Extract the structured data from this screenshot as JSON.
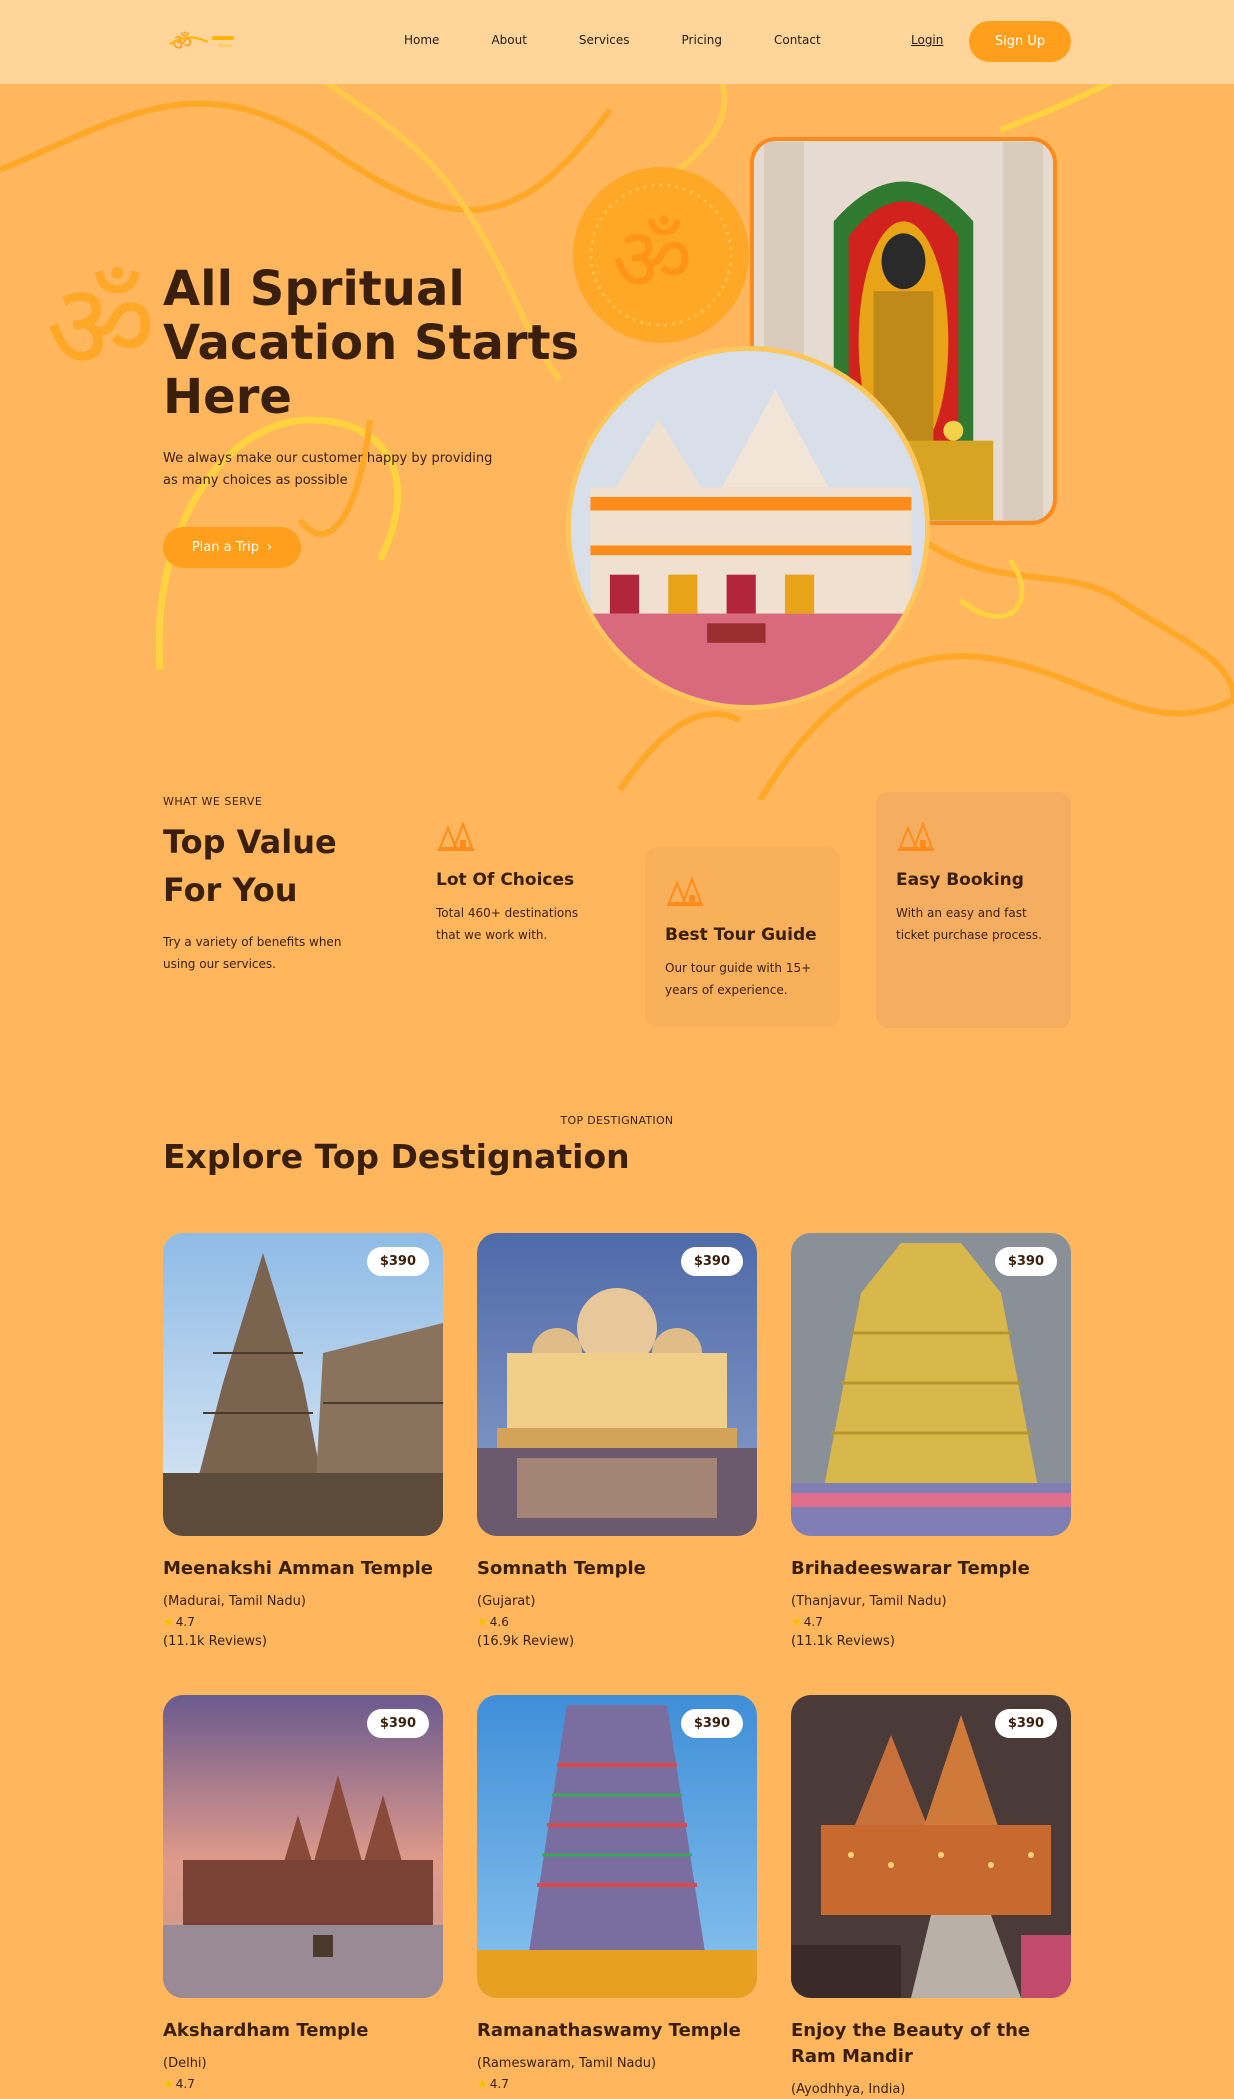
{
  "nav": {
    "links": [
      "Home",
      "About",
      "Services",
      "Pricing",
      "Contact"
    ],
    "login": "Login",
    "signup": "Sign Up"
  },
  "hero": {
    "title": "All Spritual Vacation Starts Here",
    "subtitle": "We always make our customer happy by providing as many choices as possible",
    "cta": "Plan a Trip"
  },
  "serve": {
    "kicker": "WHAT WE SERVE",
    "title": "Top Value For You",
    "subtitle": "Try a variety of benefits when using our services.",
    "cards": [
      {
        "title": "Lot Of Choices",
        "text": "Total 460+ destinations that we work with."
      },
      {
        "title": "Best Tour Guide",
        "text": "Our tour guide with 15+ years of experience."
      },
      {
        "title": "Easy Booking",
        "text": "With an easy and fast ticket purchase process."
      }
    ]
  },
  "destinations": {
    "kicker": "TOP DESTIGNATION",
    "title": "Explore Top Destignation",
    "items": [
      {
        "price": "$390",
        "name": "Meenakshi Amman Temple",
        "location": "(Madurai, Tamil Nadu)",
        "rating": "4.7",
        "reviews": "(11.1k Reviews)"
      },
      {
        "price": "$390",
        "name": "Somnath Temple",
        "location": "(Gujarat)",
        "rating": "4.6",
        "reviews": "(16.9k Review)"
      },
      {
        "price": "$390",
        "name": "Brihadeeswarar Temple",
        "location": "(Thanjavur, Tamil Nadu)",
        "rating": "4.7",
        "reviews": "(11.1k Reviews)"
      },
      {
        "price": "$390",
        "name": "Akshardham Temple",
        "location": "(Delhi)",
        "rating": "4.7",
        "reviews": ""
      },
      {
        "price": "$390",
        "name": "Ramanathaswamy Temple",
        "location": "(Rameswaram, Tamil Nadu)",
        "rating": "4.7",
        "reviews": ""
      },
      {
        "price": "$390",
        "name": "Enjoy the Beauty of the Ram Mandir",
        "location": "(Ayodhhya, India)",
        "rating": "",
        "reviews": ""
      }
    ]
  },
  "colors": {
    "accent": "#ff9f1c",
    "background": "#ffb65c",
    "text": "#3a1f0d"
  },
  "icons": [
    "om-logo-icon",
    "om-symbol-icon",
    "temple-icon",
    "chevron-right-icon",
    "star-icon"
  ]
}
